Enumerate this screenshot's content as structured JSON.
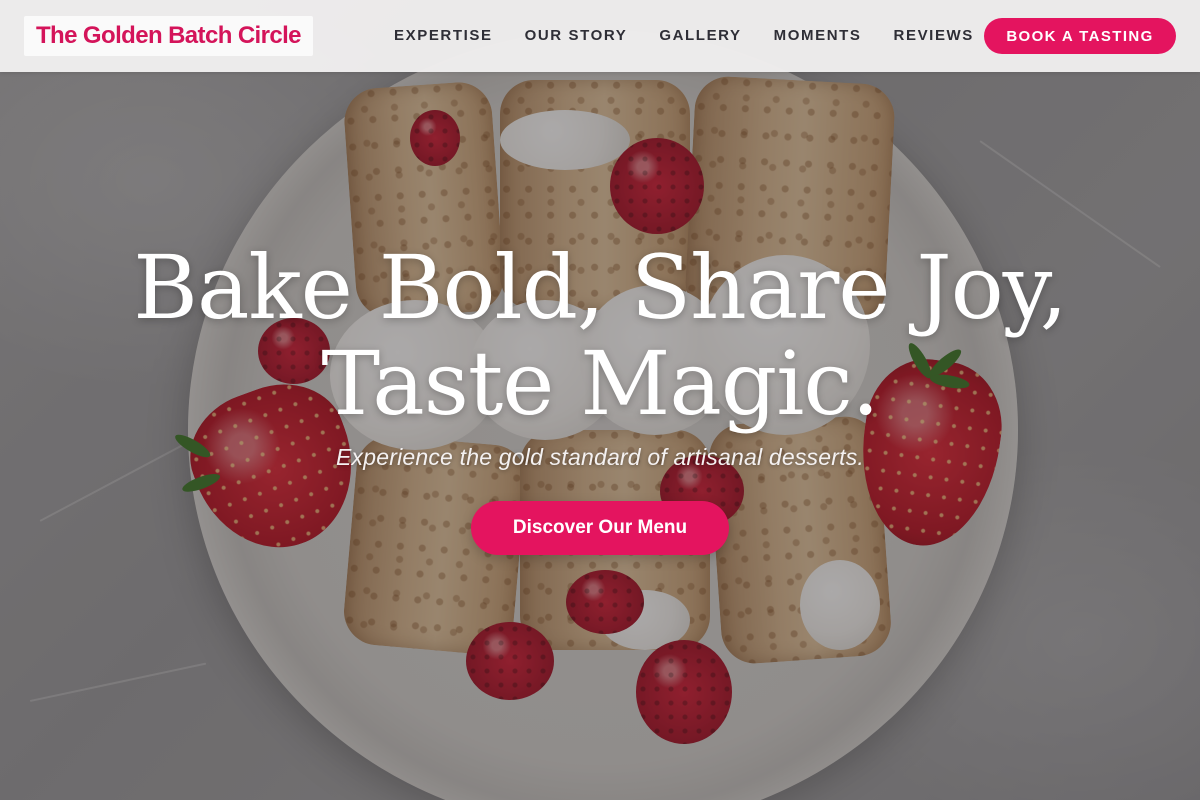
{
  "brand": {
    "name": "The Golden Batch Circle",
    "color": "#d4145a"
  },
  "nav": {
    "links": [
      {
        "label": "EXPERTISE"
      },
      {
        "label": "OUR STORY"
      },
      {
        "label": "GALLERY"
      },
      {
        "label": "MOMENTS"
      },
      {
        "label": "REVIEWS"
      }
    ],
    "cta_label": "BOOK A TASTING"
  },
  "hero": {
    "title_line1": "Bake Bold, Share Joy,",
    "title_line2": "Taste Magic.",
    "subtitle": "Experience the gold standard of artisanal desserts.",
    "button_label": "Discover Our Menu"
  },
  "colors": {
    "accent": "#e4145f",
    "nav_background": "#f0eeee",
    "nav_text": "#2e2e36"
  }
}
